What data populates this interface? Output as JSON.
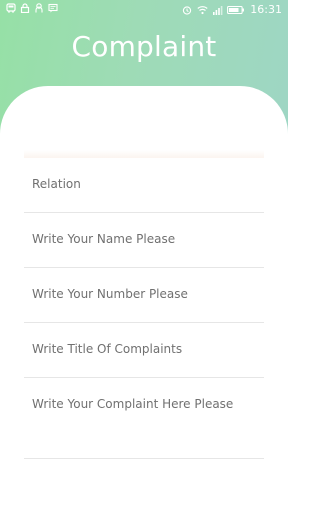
{
  "status_bar": {
    "time": "16:31",
    "icons": [
      "bus-icon",
      "lock-icon",
      "robot-icon",
      "message-icon",
      "alarm-icon",
      "wifi-icon",
      "signal-icon",
      "battery-icon"
    ]
  },
  "header": {
    "title": "Complaint",
    "gradient": [
      "#96e0a6",
      "#9ed6c4"
    ]
  },
  "form": {
    "fields": [
      {
        "label": "Relation"
      },
      {
        "label": "Write Your Name Please"
      },
      {
        "label": "Write Your Number Please"
      },
      {
        "label": "Write Title Of Complaints"
      },
      {
        "label": "Write Your Complaint Here Please"
      }
    ]
  }
}
